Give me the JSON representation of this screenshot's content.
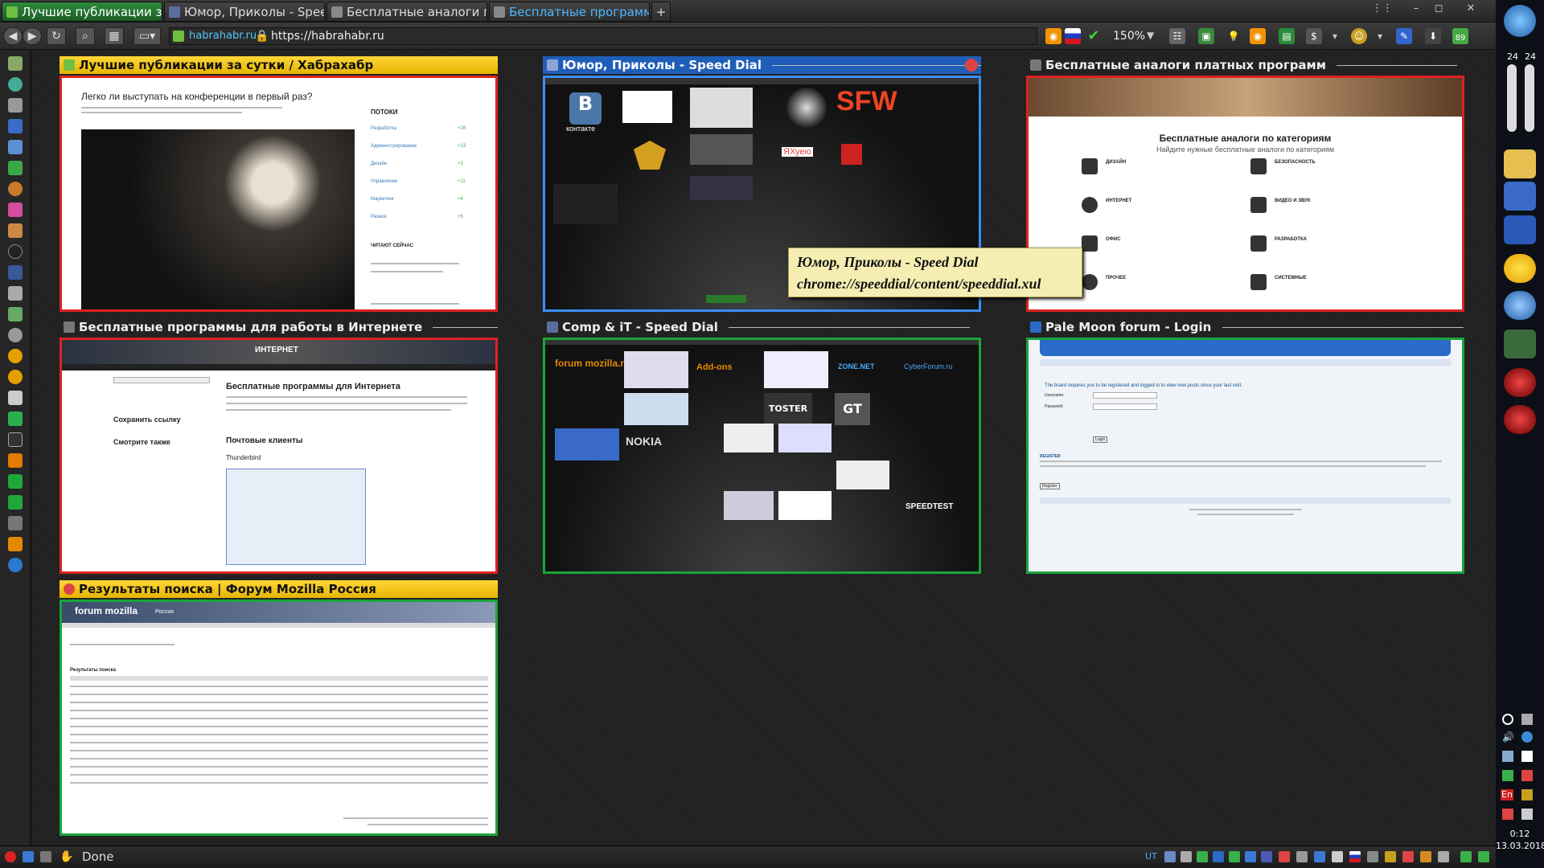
{
  "tabs": [
    {
      "label": "Лучшие публикации за сутки / ...",
      "active": true
    },
    {
      "label": "Юмор, Приколы - Speed Dial",
      "active": false
    },
    {
      "label": "Бесплатные аналоги платных ...",
      "active": false
    },
    {
      "label": "Бесплатные программы для ра...",
      "active": false,
      "selected": true
    }
  ],
  "navbar": {
    "site_label": "habrahabr.ru",
    "url": "https://habrahabr.ru",
    "zoom": "150%",
    "badge": "89"
  },
  "tiles": [
    {
      "title": "Лучшие публикации за сутки / Хабрахабр",
      "style": "yellow"
    },
    {
      "title": "Юмор, Приколы - Speed Dial",
      "style": "blue"
    },
    {
      "title": "Бесплатные аналоги платных программ",
      "style": "dark"
    },
    {
      "title": "Бесплатные программы для работы в Интернете",
      "style": "dark"
    },
    {
      "title": "Comp & iT - Speed Dial",
      "style": "dark"
    },
    {
      "title": "Pale Moon forum - Login",
      "style": "dark"
    },
    {
      "title": "Результаты поиска | Форум Mozilla Россия",
      "style": "yellow"
    }
  ],
  "thumb_habr": {
    "heading": "Легко ли выступать на конференции в первый раз?",
    "side_title": "ПОТОКИ",
    "side_items": [
      "Разработка",
      "Администрирование",
      "Дизайн",
      "Управление",
      "Маркетинг",
      "Разное"
    ],
    "side_counts": [
      "+28",
      "+13",
      "+3",
      "+11",
      "+4",
      "+6"
    ],
    "reading": "ЧИТАЮТ СЕЙЧАС"
  },
  "thumb_humor": {
    "labels": [
      "SFW",
      "ЯХуею",
      "контакте"
    ]
  },
  "thumb_analogs": {
    "heading": "Бесплатные аналоги по категориям",
    "subheading": "Найдите нужные бесплатные аналоги по категориям",
    "categories": [
      "ДИЗАЙН",
      "БЕЗОПАСНОСТЬ",
      "ИНТЕРНЕТ",
      "ВИДЕО И ЗВУК",
      "ОФИС",
      "РАЗРАБОТКА",
      "ПРОЧЕЕ",
      "СИСТЕМНЫЕ"
    ]
  },
  "thumb_progs": {
    "banner": "ИНТЕРНЕТ",
    "heading": "Бесплатные программы для Интернета",
    "save": "Сохранить ссылку",
    "see_also": "Смотрите также",
    "mail": "Почтовые клиенты",
    "app": "Thunderbird"
  },
  "thumb_comp": {
    "labels": [
      "forum mozilla.ru",
      "TOSTER",
      "GT",
      "NOKIA",
      "ZONE.NET",
      "CyberForum.ru",
      "SPEEDTEST",
      "Add-ons"
    ]
  },
  "thumb_palemoon": {
    "notice": "The board requires you to be registered and logged in to view new posts since your last visit.",
    "username": "Username:",
    "password": "Password:",
    "login_btn": "Login",
    "register": "REGISTER",
    "register_btn": "Register"
  },
  "thumb_mozilla": {
    "brand": "forum mozilla",
    "brand_sub": "Россия",
    "results": "Результаты поиска"
  },
  "tooltip": {
    "line1": "Юмор, Приколы - Speed Dial",
    "line2": "chrome://speeddial/content/speeddial.xul"
  },
  "status": {
    "text": "Done"
  },
  "right": {
    "vol_left": "24",
    "vol_right": "24",
    "time": "0:12",
    "date": "13.03.2018",
    "lang": "En"
  },
  "colors": {
    "tab_active": "#2f8a3c",
    "tile_border_red": "#dd2222",
    "tile_border_green": "#1aa53a",
    "tile_border_blue": "#3a8ef5",
    "tile_bar_yellow": "#ffd738",
    "tooltip_bg": "#f5edb2"
  }
}
